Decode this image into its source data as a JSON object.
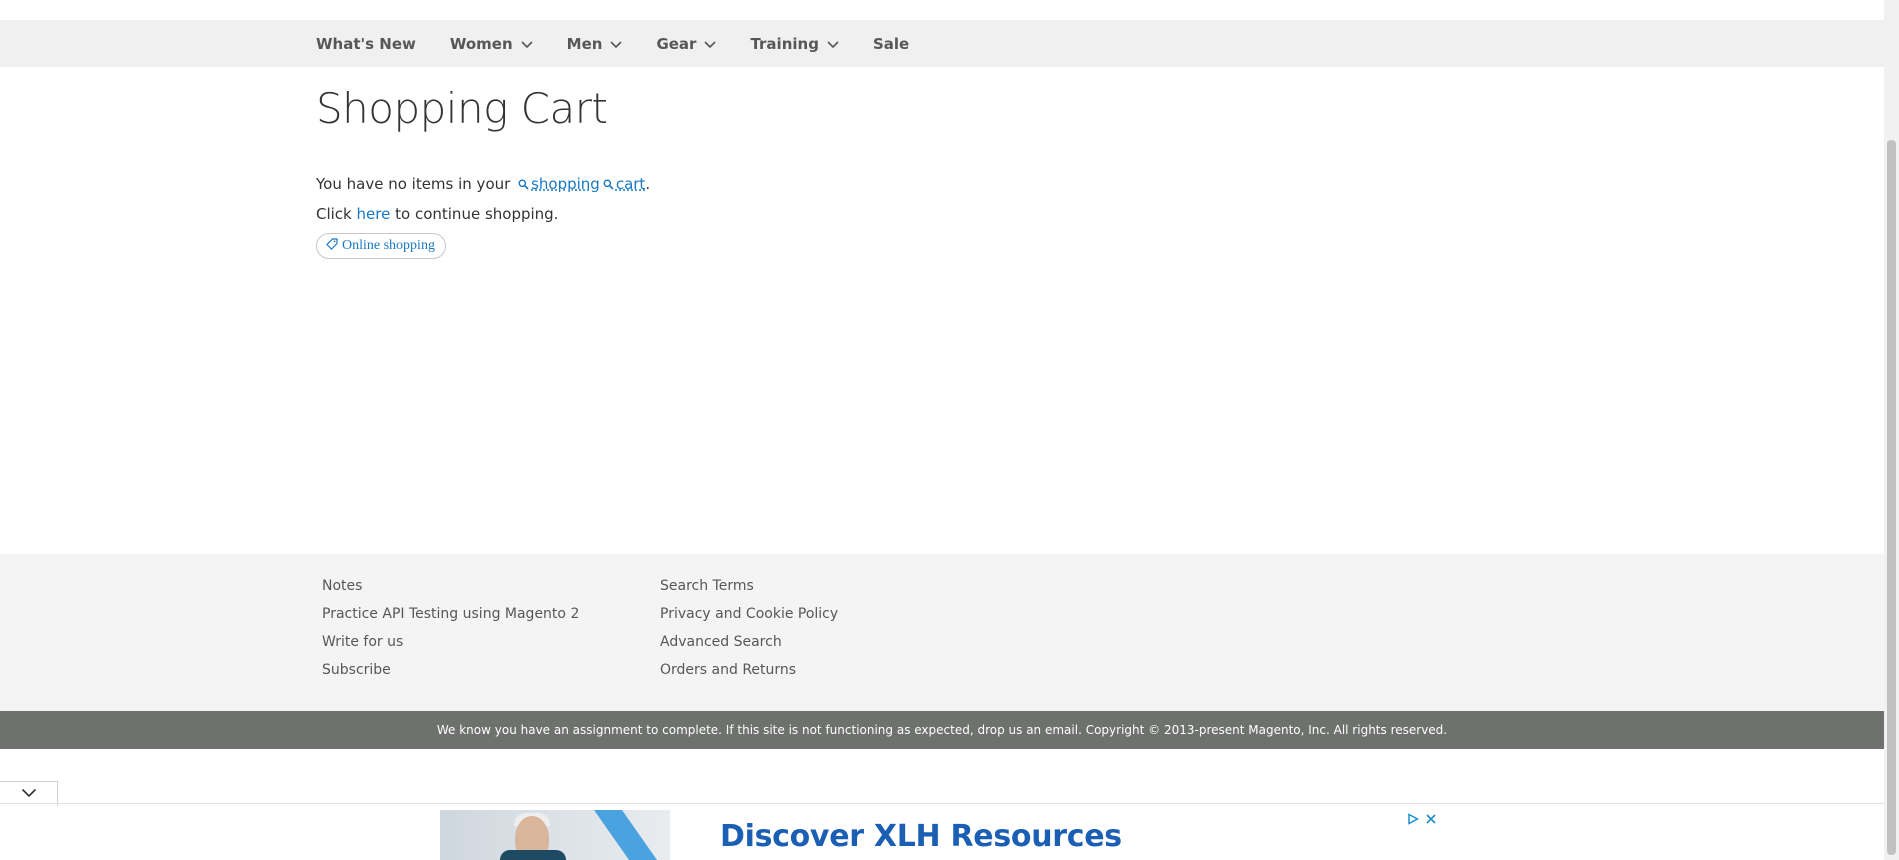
{
  "nav": {
    "items": [
      {
        "label": "What's New",
        "has_dropdown": false
      },
      {
        "label": "Women",
        "has_dropdown": true
      },
      {
        "label": "Men",
        "has_dropdown": true
      },
      {
        "label": "Gear",
        "has_dropdown": true
      },
      {
        "label": "Training",
        "has_dropdown": true
      },
      {
        "label": "Sale",
        "has_dropdown": false
      }
    ]
  },
  "page": {
    "title": "Shopping Cart",
    "empty_text_prefix": "You have no items in your",
    "empty_link_1": "shopping",
    "empty_link_2": "cart",
    "empty_text_suffix": ".",
    "continue_prefix": "Click",
    "continue_link": "here",
    "continue_suffix": "to continue shopping.",
    "chip_label": "Online shopping"
  },
  "footer": {
    "col1": [
      "Notes",
      "Practice API Testing using Magento 2",
      "Write for us",
      "Subscribe"
    ],
    "col2": [
      "Search Terms",
      "Privacy and Cookie Policy",
      "Advanced Search",
      "Orders and Returns"
    ],
    "copyright": "We know you have an assignment to complete. If this site is not functioning as expected, drop us an email. Copyright © 2013-present Magento, Inc. All rights reserved."
  },
  "ad": {
    "headline": "Discover XLH Resources"
  },
  "colors": {
    "link": "#1979c3",
    "nav_bg": "#f0f0f0",
    "footer_bg": "#f4f4f4",
    "copyright_bg": "#6e716e",
    "ad_headline": "#1a5fb4"
  },
  "icons": {
    "nav_dropdown": "chevron-down-icon",
    "keyword_link": "search-icon",
    "chip": "tag-icon",
    "collapse": "chevron-down-icon",
    "ad_info": "adchoices-icon",
    "ad_close": "close-icon"
  }
}
